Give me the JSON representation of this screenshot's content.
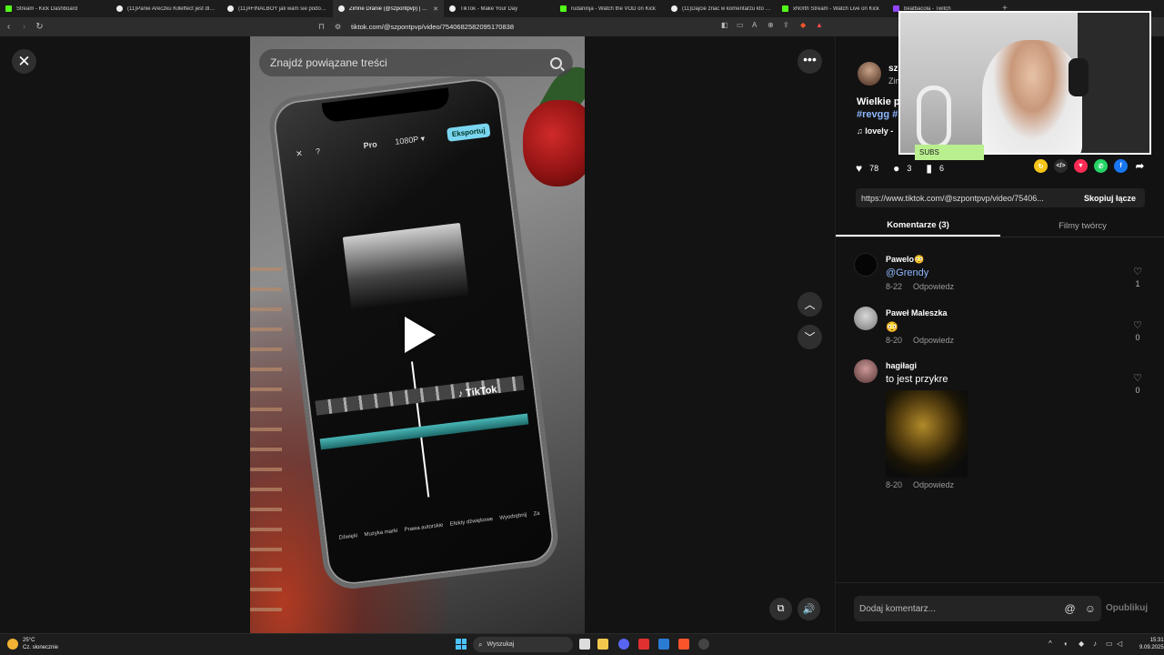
{
  "browser": {
    "tabs": [
      {
        "title": "Stream - Kick Dashboard",
        "color": "#53fc18"
      },
      {
        "title": "(11)Panie Areczku Killeffect jest dla c...",
        "color": "#ffffff"
      },
      {
        "title": "(11)#FINALBOY jali wam sie podoba...",
        "color": "#ffffff"
      },
      {
        "title": "Zimne Dranie (@szpontpvp) | Ti...",
        "color": "#ffffff",
        "active": true
      },
      {
        "title": "TikTok - Make Your Day",
        "color": "#ffffff"
      },
      {
        "title": "rudaninja - Watch the VOD on Kick",
        "color": "#53fc18"
      },
      {
        "title": "(11)Dajcie znac w komentarzu kto d...",
        "color": "#ffffff"
      },
      {
        "title": "xN0rth Stream - Watch Live on Kick",
        "color": "#53fc18"
      },
      {
        "title": "beatbacola - Twitch",
        "color": "#9146ff"
      }
    ],
    "url": "tiktok.com/@szpontpvp/video/7540682582095170838"
  },
  "video": {
    "search_placeholder": "Znajdź powiązane treści",
    "phone": {
      "pro": "Pro",
      "resolution": "1080P ▾",
      "export": "Eksportuj",
      "watermark": "♪ TikTok",
      "toolbar": [
        "Dźwięki",
        "Muzyka marki",
        "Prawa autorskie",
        "Efekty dźwiękowe",
        "Wyodrębnij",
        "Za"
      ]
    }
  },
  "panel": {
    "author_name": "sz",
    "author_sub": "Zim",
    "description": "Wielkie p",
    "tags": "#revgg #",
    "music": "♫  lovely -",
    "likes": "78",
    "comments_count": "3",
    "saves": "6",
    "link": "https://www.tiktok.com/@szpontpvp/video/75406...",
    "copy_label": "Skopiuj łącze",
    "tab_comments": "Komentarze (3)",
    "tab_creator": "Filmy twórcy",
    "comments": [
      {
        "name": "Pawelo",
        "badge": "😳",
        "text": "@Grendy",
        "date": "8-22",
        "reply": "Odpowiedz",
        "likes": "1"
      },
      {
        "name": "Paweł Maleszka",
        "badge": "",
        "text": "😳",
        "date": "8-20",
        "reply": "Odpowiedz",
        "likes": "0"
      },
      {
        "name": "hagiłagi",
        "badge": "",
        "text": "to jest przykre",
        "date": "8-20",
        "reply": "Odpowiedz",
        "likes": "0"
      }
    ],
    "comment_placeholder": "Dodaj komentarz...",
    "publish": "Opublikuj"
  },
  "overlay": {
    "subs_label": "SUBS"
  },
  "taskbar": {
    "temp": "25°C",
    "weather": "Cz. słonecznie",
    "search": "Wyszukaj",
    "time": "15:31",
    "date": "9.09.2025"
  }
}
